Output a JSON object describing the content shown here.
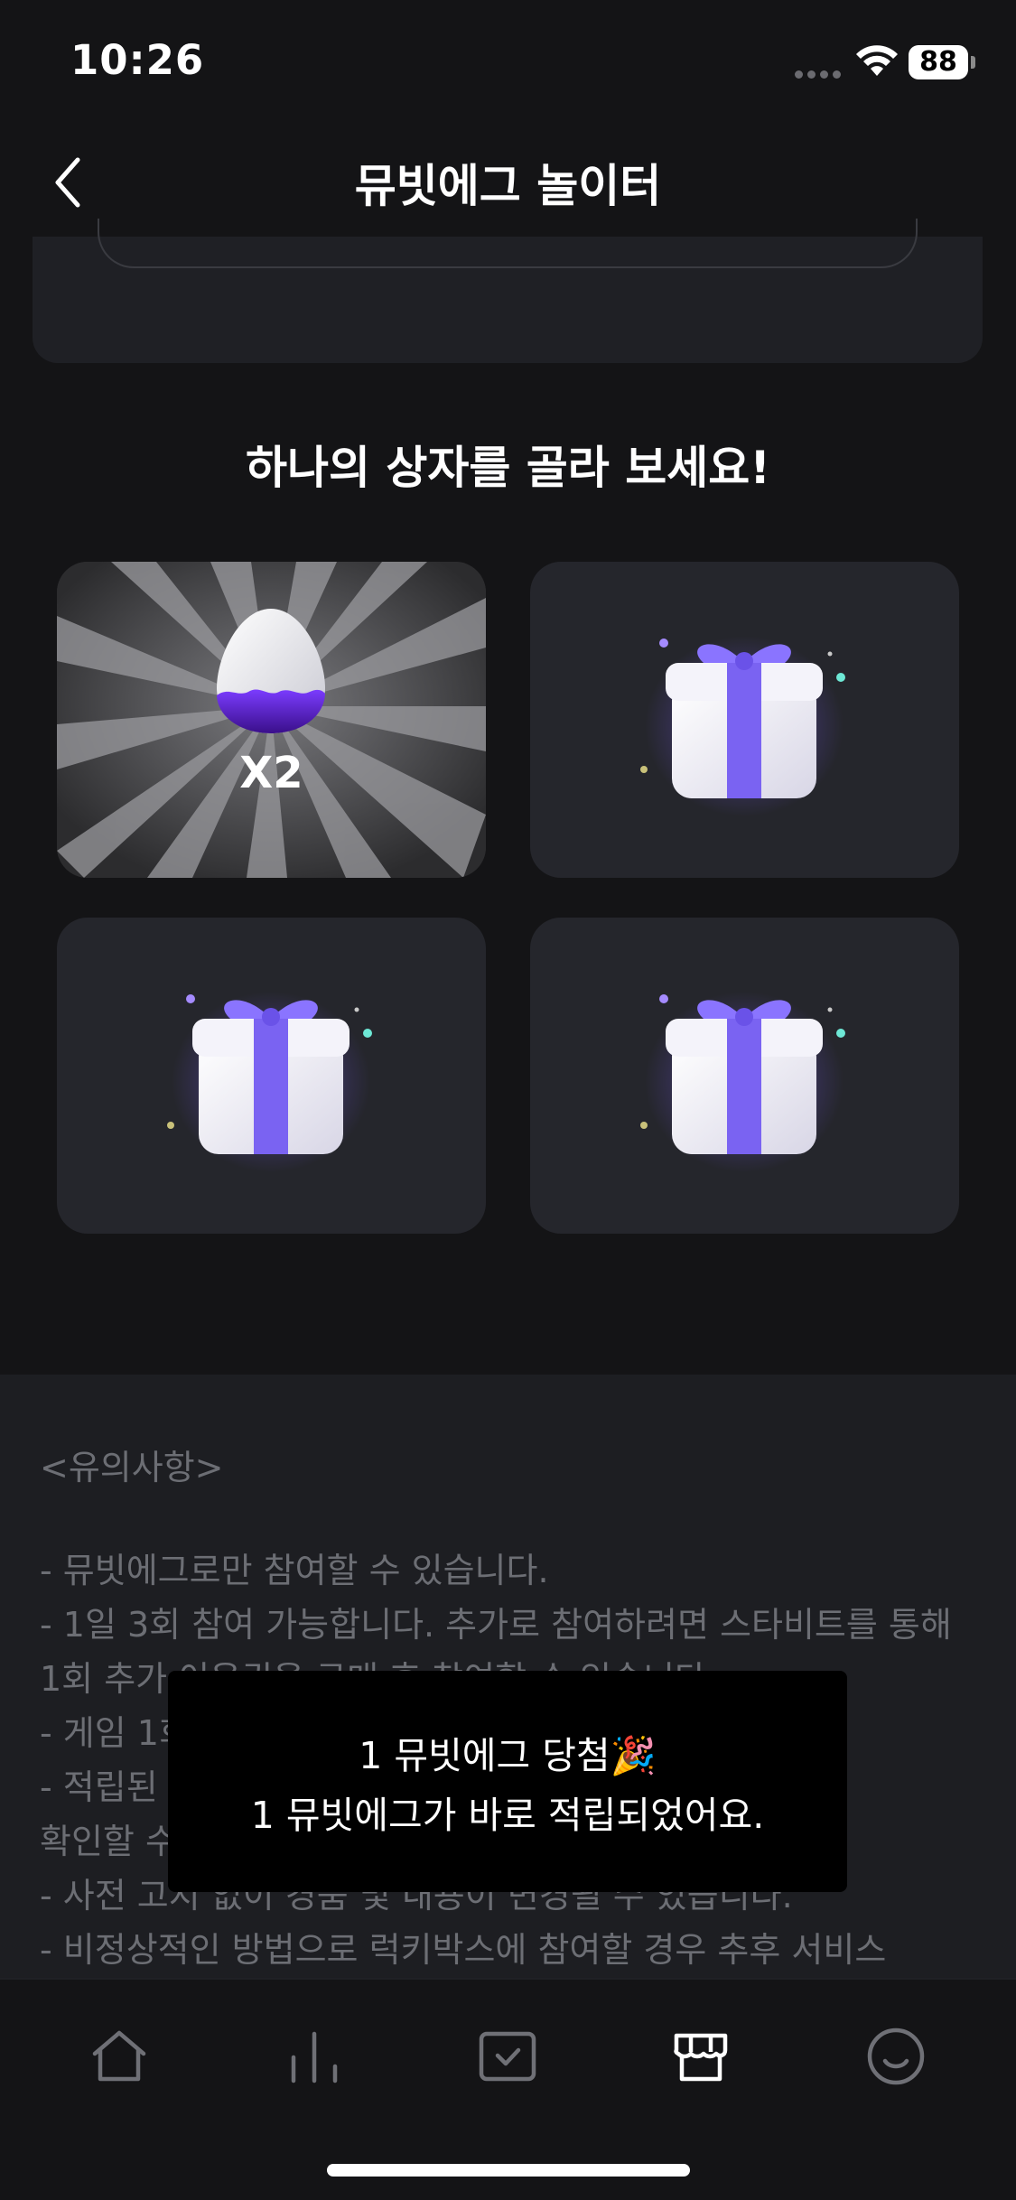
{
  "status_bar": {
    "time": "10:26",
    "battery": "88"
  },
  "header": {
    "title": "뮤빗에그 놀이터"
  },
  "prompt": "하나의 상자를 골라 보세요!",
  "boxes": [
    {
      "type": "revealed",
      "reward_label": "X2"
    },
    {
      "type": "gift"
    },
    {
      "type": "gift"
    },
    {
      "type": "gift"
    }
  ],
  "notice": {
    "heading": "<유의사항>",
    "lines": [
      "- 뮤빗에그로만 참여할 수 있습니다.",
      "- 1일 3회 참여 가능합니다. 추가로 참여하려면 스타비트를 통해",
      "1회 추가 이용권을 구매 후 참여할 수 있습니다.",
      "- 게임 1회 당 최대 10개까지 가능합니다.",
      "- 적립된 뮤빗에그는 [마이페이지 > 마이뮤빗에그] 에서",
      "확인할 수 있습니다.",
      "- 사전 고지 없이 경품 및 내용이 변경될 수 있습니다.",
      "- 비정상적인 방법으로 럭키박스에 참여할 경우 추후 서비스"
    ]
  },
  "toast": {
    "line1": "1 뮤빗에그 당첨🎉",
    "line2": "1 뮤빗에그가 바로 적립되었어요."
  },
  "tab_bar": {
    "items": [
      "home-icon",
      "chart-icon",
      "vote-icon",
      "store-icon",
      "profile-icon"
    ],
    "active": "store-icon"
  },
  "colors": {
    "accent": "#7b5cff",
    "egg_purple": "#5b1fb8",
    "background": "#141416"
  }
}
